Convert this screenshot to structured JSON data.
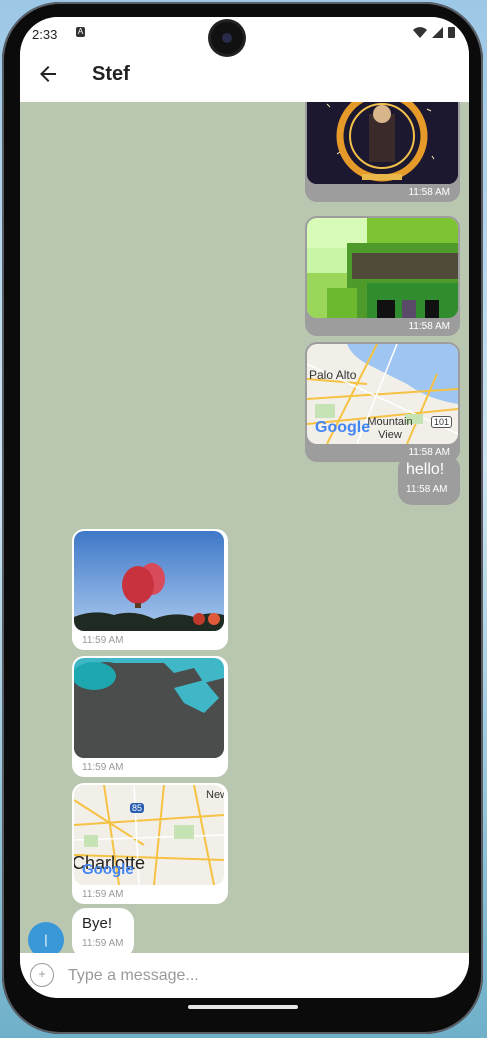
{
  "status": {
    "time": "2:33",
    "indicator": "A"
  },
  "header": {
    "title": "Stef"
  },
  "messages_out": [
    {
      "kind": "image",
      "image": "movie-poster",
      "time": "11:58 AM"
    },
    {
      "kind": "image",
      "image": "pixel-art",
      "time": "11:58 AM"
    },
    {
      "kind": "map",
      "labels": [
        "Palo Alto",
        "Mountain View"
      ],
      "brand": "Google",
      "shield": "101",
      "time": "11:58 AM"
    },
    {
      "kind": "text",
      "text": "hello!",
      "time": "11:58 AM"
    }
  ],
  "messages_in": [
    {
      "kind": "image",
      "image": "hot-air-balloons",
      "time": "11:59 AM"
    },
    {
      "kind": "image",
      "image": "abstract-shapes",
      "time": "11:59 AM"
    },
    {
      "kind": "map",
      "labels": [
        "Charlotte",
        "New"
      ],
      "brand": "Google",
      "shield": "85",
      "time": "11:59 AM"
    },
    {
      "kind": "text",
      "text": "Bye!",
      "time": "11:59 AM"
    }
  ],
  "avatar": {
    "initial": "|",
    "color": "#3a98d8"
  },
  "composer": {
    "placeholder": "Type a message..."
  },
  "colors": {
    "chat_bg": "#b9c6b0",
    "outgoing": "#9d9d9d",
    "incoming": "#ffffff"
  }
}
